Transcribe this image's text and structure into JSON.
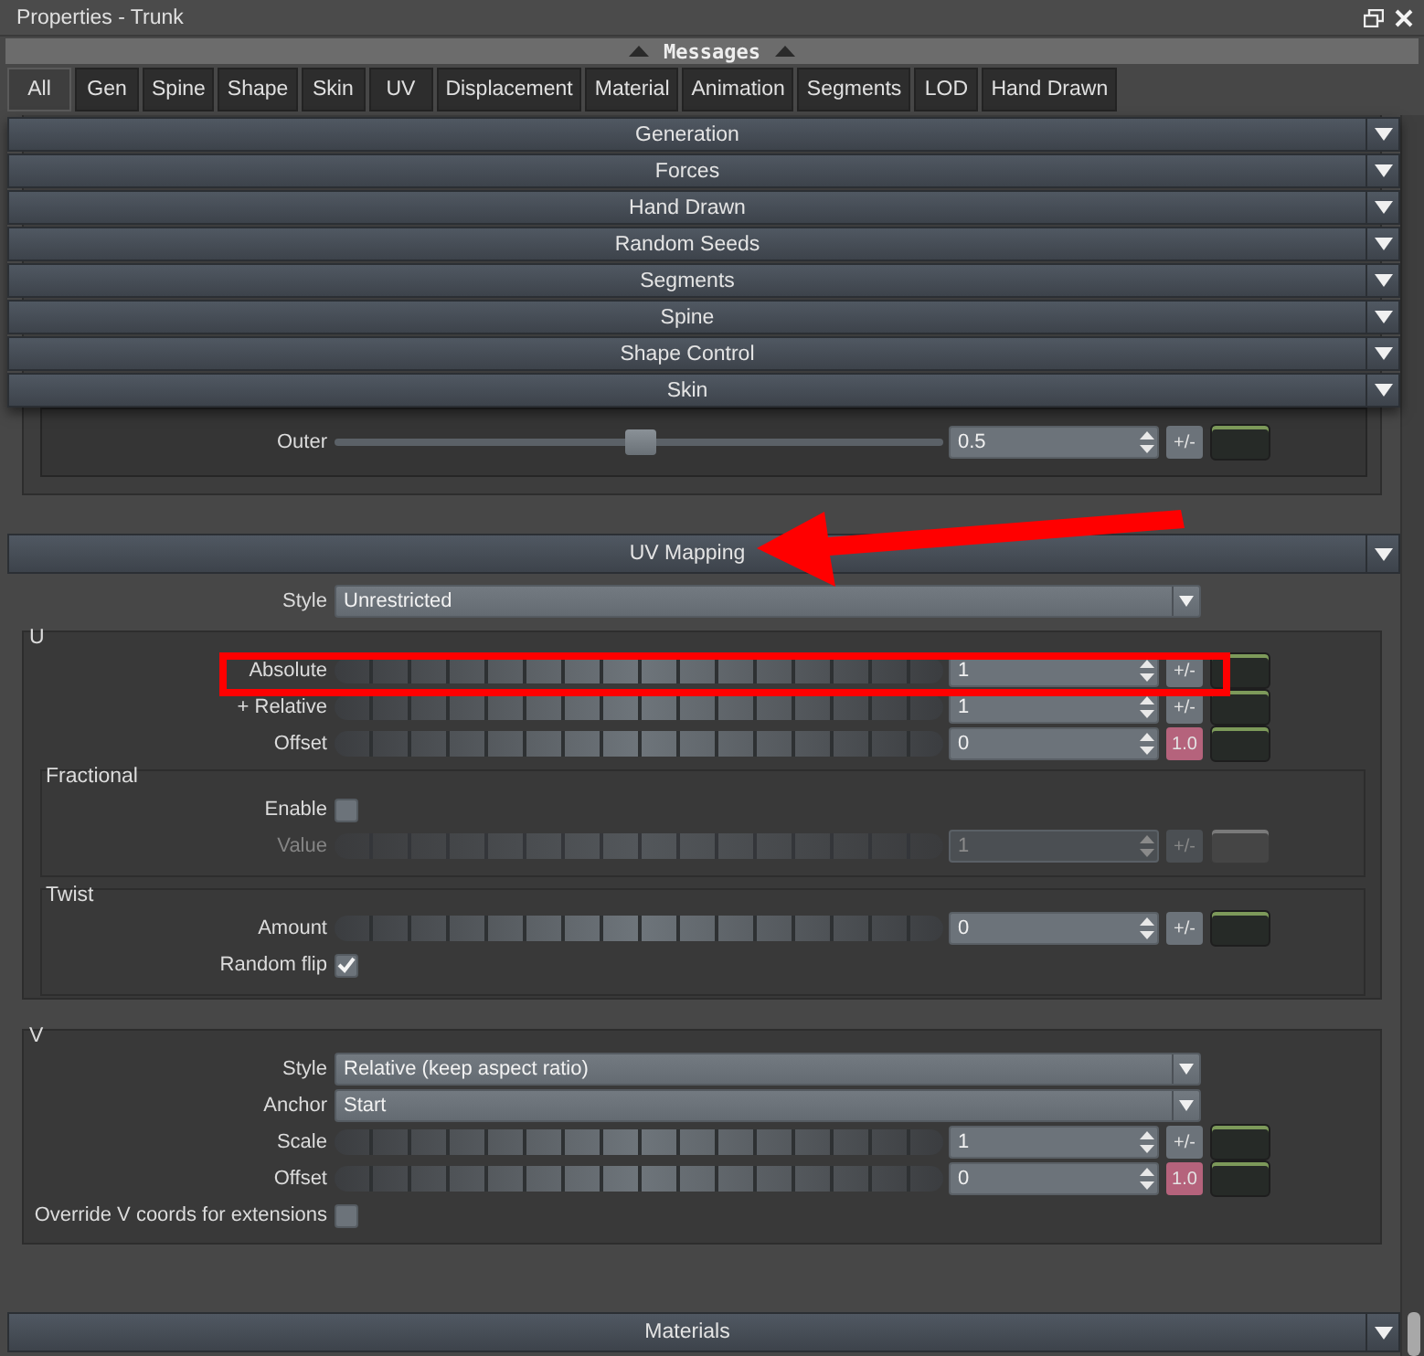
{
  "window": {
    "title": "Properties - Trunk"
  },
  "messages_bar": {
    "label": "Messages"
  },
  "tabs": [
    {
      "label": "All",
      "selected": true
    },
    {
      "label": "Gen",
      "selected": false
    },
    {
      "label": "Spine",
      "selected": false
    },
    {
      "label": "Shape",
      "selected": false
    },
    {
      "label": "Skin",
      "selected": false
    },
    {
      "label": "UV",
      "selected": false
    },
    {
      "label": "Displacement",
      "selected": false
    },
    {
      "label": "Material",
      "selected": false
    },
    {
      "label": "Animation",
      "selected": false
    },
    {
      "label": "Segments",
      "selected": false
    },
    {
      "label": "LOD",
      "selected": false
    },
    {
      "label": "Hand Drawn",
      "selected": false
    }
  ],
  "section_menu": [
    {
      "label": "Generation"
    },
    {
      "label": "Forces"
    },
    {
      "label": "Hand Drawn"
    },
    {
      "label": "Random Seeds"
    },
    {
      "label": "Segments"
    },
    {
      "label": "Spine"
    },
    {
      "label": "Shape Control"
    },
    {
      "label": "Skin"
    }
  ],
  "skin": {
    "rows": [
      {
        "kind": "slider",
        "label": "Outer",
        "level": 0.5,
        "value": "0.5",
        "button": {
          "label": "+/-",
          "on": false
        }
      }
    ]
  },
  "uv_mapping": {
    "title": "UV Mapping",
    "rows": [
      {
        "kind": "dropdown",
        "label": "Style",
        "value": "Unrestricted"
      }
    ],
    "groups": [
      {
        "title": "U",
        "rows": [
          {
            "kind": "jog",
            "label": "Absolute",
            "value": "1",
            "button": {
              "label": "+/-",
              "on": false
            }
          },
          {
            "kind": "jog",
            "label": "+ Relative",
            "value": "1",
            "button": {
              "label": "+/-",
              "on": false
            }
          },
          {
            "kind": "jog",
            "label": "Offset",
            "value": "0",
            "button": {
              "label": "1.0",
              "on": true
            }
          }
        ],
        "subgroups": [
          {
            "title": "Fractional",
            "rows": [
              {
                "kind": "checkbox",
                "label": "Enable",
                "checked": false,
                "disabled": false
              },
              {
                "kind": "jog",
                "label": "Value",
                "value": "1",
                "button": {
                  "label": "+/-",
                  "on": false
                },
                "disabled": true
              }
            ]
          },
          {
            "title": "Twist",
            "rows": [
              {
                "kind": "jog",
                "label": "Amount",
                "value": "0",
                "button": {
                  "label": "+/-",
                  "on": false
                }
              },
              {
                "kind": "checkbox",
                "label": "Random flip",
                "checked": true
              }
            ]
          }
        ]
      },
      {
        "title": "V",
        "rows": [
          {
            "kind": "dropdown",
            "label": "Style",
            "value": "Relative (keep aspect ratio)"
          },
          {
            "kind": "dropdown",
            "label": "Anchor",
            "value": "Start"
          },
          {
            "kind": "jog",
            "label": "Scale",
            "value": "1",
            "button": {
              "label": "+/-",
              "on": false
            }
          },
          {
            "kind": "jog",
            "label": "Offset",
            "value": "0",
            "button": {
              "label": "1.0",
              "on": true
            }
          },
          {
            "kind": "checkbox",
            "label": "Override V coords for extensions",
            "checked": false
          }
        ]
      }
    ]
  },
  "materials": {
    "title": "Materials"
  }
}
